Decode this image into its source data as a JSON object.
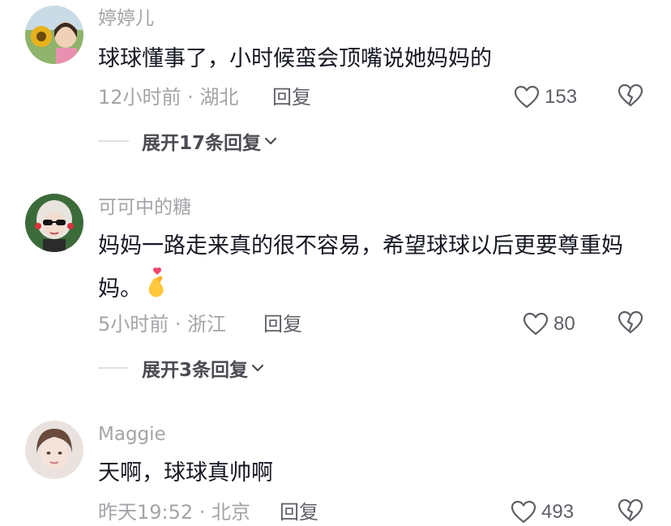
{
  "comments": [
    {
      "username": "婷婷儿",
      "text": "球球懂事了，小时候蛮会顶嘴说她妈妈的",
      "time_location": "12小时前 · 湖北",
      "reply_label": "回复",
      "likes": "153",
      "expand_label": "展开17条回复"
    },
    {
      "username": "可可中的糖",
      "text": "妈妈一路走来真的很不容易，希望球球以后更要尊重妈妈。",
      "time_location": "5小时前 · 浙江",
      "reply_label": "回复",
      "likes": "80",
      "expand_label": "展开3条回复"
    },
    {
      "username": "Maggie",
      "text": "天啊，球球真帅啊",
      "time_location": "昨天19:52 · 北京",
      "reply_label": "回复",
      "likes": "493"
    }
  ]
}
